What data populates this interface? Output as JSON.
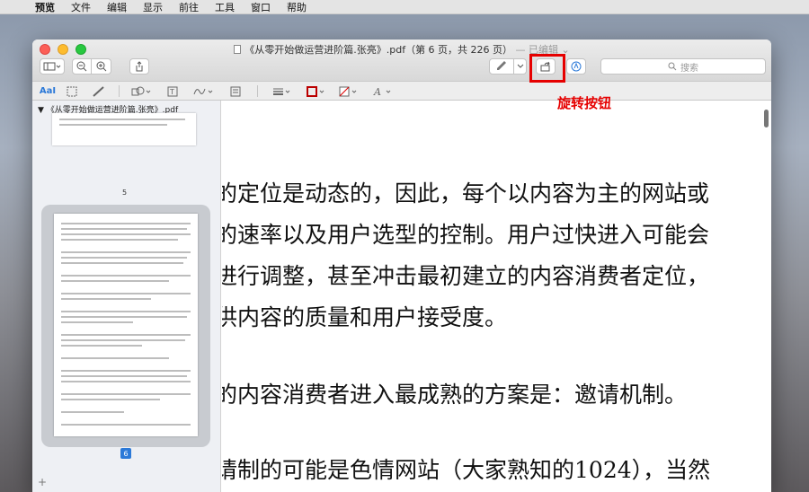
{
  "menubar": {
    "apple": "",
    "items": [
      "预览",
      "文件",
      "编辑",
      "显示",
      "前往",
      "工具",
      "窗口",
      "帮助"
    ]
  },
  "window": {
    "title": "《从零开始做运营进阶篇.张亮》.pdf（第 6 页，共 226 页）",
    "edited": "— 已编辑 ⌄"
  },
  "toolbar": {
    "search_placeholder": "搜索",
    "markup_text": "AaI",
    "zoom_out": "−",
    "zoom_in": "+"
  },
  "sidebar": {
    "file_title": "《从零开始做运营进阶篇.张亮》.pdf",
    "page5": "5",
    "page6": "6",
    "add": "+"
  },
  "content": {
    "lines": [
      "的定位是动态的，因此，每个以内容为主的网站或",
      "的速率以及用户选型的控制。用户过快进入可能会",
      "进行调整，甚至冲击最初建立的内容消费者定位，",
      "供内容的质量和用户接受度。",
      "的内容消费者进入最成熟的方案是：邀请机制。",
      "请制的可能是色情网站（大家熟知的1024），当然"
    ]
  },
  "annotation": {
    "label": "旋转按钮",
    "color": "#e60000"
  }
}
